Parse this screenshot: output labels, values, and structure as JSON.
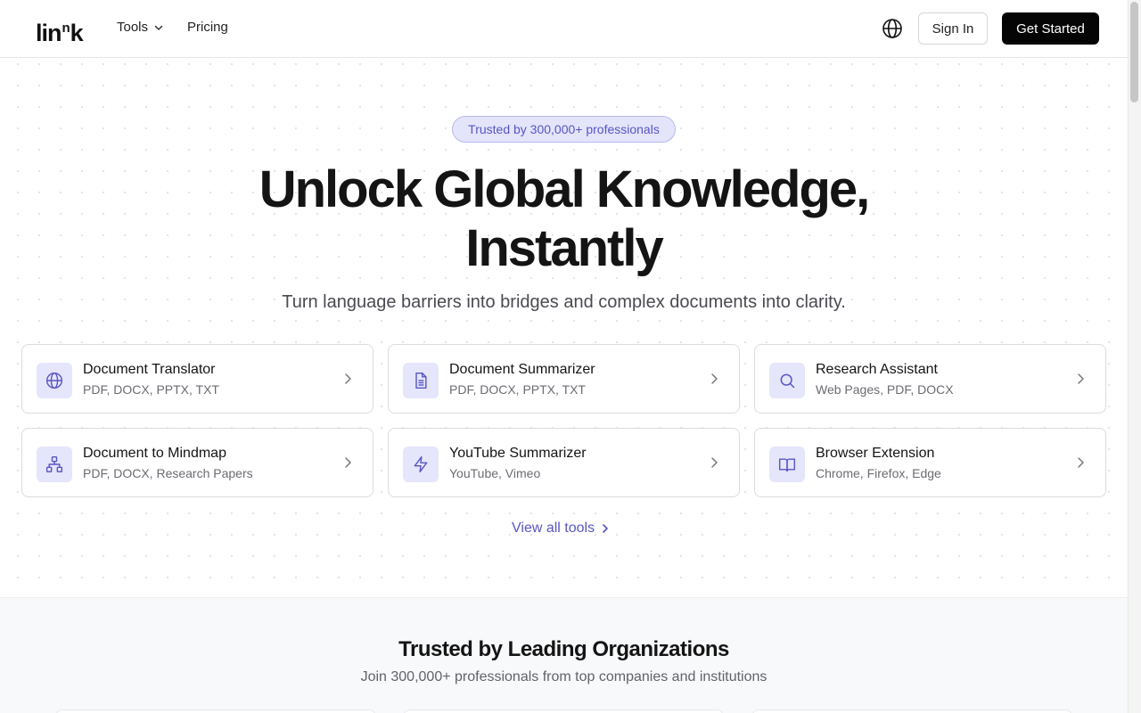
{
  "header": {
    "logo": {
      "part1": "lin",
      "sup": "n",
      "part2": "k"
    },
    "nav_tools": "Tools",
    "nav_pricing": "Pricing",
    "sign_in": "Sign In",
    "get_started": "Get Started"
  },
  "hero": {
    "badge": "Trusted by 300,000+ professionals",
    "title_line1": "Unlock Global Knowledge,",
    "title_line2": "Instantly",
    "subtitle": "Turn language barriers into bridges and complex documents into clarity."
  },
  "tools": [
    {
      "title": "Document Translator",
      "formats": "PDF, DOCX, PPTX, TXT",
      "icon": "globe-icon"
    },
    {
      "title": "Document Summarizer",
      "formats": "PDF, DOCX, PPTX, TXT",
      "icon": "document-icon"
    },
    {
      "title": "Research Assistant",
      "formats": "Web Pages, PDF, DOCX",
      "icon": "search-icon"
    },
    {
      "title": "Document to Mindmap",
      "formats": "PDF, DOCX, Research Papers",
      "icon": "sitemap-icon"
    },
    {
      "title": "YouTube Summarizer",
      "formats": "YouTube, Vimeo",
      "icon": "lightning-icon"
    },
    {
      "title": "Browser Extension",
      "formats": "Chrome, Firefox, Edge",
      "icon": "book-icon"
    }
  ],
  "view_all": "View all tools",
  "trusted": {
    "title": "Trusted by Leading Organizations",
    "subtitle": "Join 300,000+ professionals from top companies and institutions"
  },
  "colors": {
    "accent": "#5856c4",
    "icon_bg": "#e5e5fb",
    "primary_button": "#050505"
  }
}
